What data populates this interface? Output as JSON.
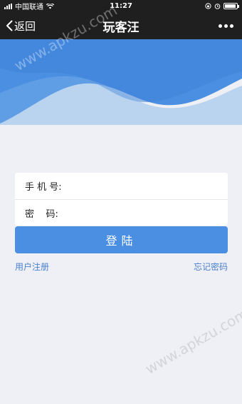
{
  "status_bar": {
    "carrier": "中国联通",
    "time": "11:27",
    "battery_level": 0.95
  },
  "nav": {
    "back_label": "返回",
    "title": "玩客汪",
    "more_icon": "more-dots-icon"
  },
  "form": {
    "phone_label": "手 机 号:",
    "phone_value": "",
    "password_label": "密    码:",
    "password_value": ""
  },
  "login_button_label": "登陆",
  "register_link": "用户注册",
  "forgot_link": "忘记密码",
  "watermark": "www.apkzu.com",
  "colors": {
    "primary": "#4a8fe2",
    "banner_blue": "#4a8fe2",
    "background": "#eff0f5",
    "link": "#4a7fcf"
  }
}
